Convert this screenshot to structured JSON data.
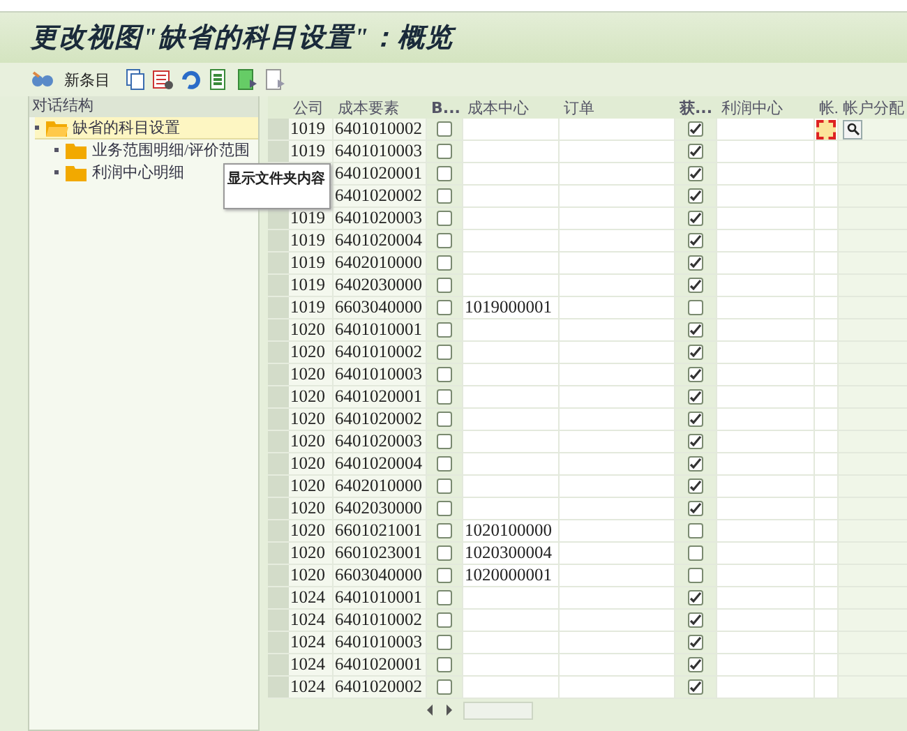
{
  "window": {
    "title": "更改视图\"缺省的科目设置\"：概览"
  },
  "toolbar": {
    "new_entry": "新条目"
  },
  "tree": {
    "header": "对话结构",
    "items": [
      {
        "label": "缺省的科目设置",
        "selected": true,
        "expanded": true,
        "children": [
          {
            "label": "业务范围明细/评价范围",
            "selected": false
          },
          {
            "label": "利润中心明细",
            "selected": false
          }
        ]
      }
    ]
  },
  "tooltip": "显示文件夹内容",
  "table": {
    "columns": [
      "公司",
      "成本要素",
      "B...",
      "成本中心",
      "订单",
      "获...",
      "利润中心",
      "帐.",
      "帐户分配"
    ],
    "rows": [
      {
        "company": "1019",
        "cost_element": "6401010002",
        "b_checked": false,
        "cost_center": "",
        "obtain_checked": true,
        "input_active": true
      },
      {
        "company": "1019",
        "cost_element": "6401010003",
        "b_checked": false,
        "obtain_checked": true,
        "input_active": false
      },
      {
        "cost_element": "6401020001",
        "b_checked": false,
        "obtain_checked": true,
        "input_active": false
      },
      {
        "cost_element": "6401020002",
        "b_checked": false,
        "obtain_checked": true,
        "input_active": false
      },
      {
        "company": "1019",
        "cost_element": "6401020003",
        "b_checked": false,
        "obtain_checked": true,
        "input_active": false
      },
      {
        "company": "1019",
        "cost_element": "6401020004",
        "b_checked": false,
        "obtain_checked": true,
        "input_active": false
      },
      {
        "company": "1019",
        "cost_element": "6402010000",
        "b_checked": false,
        "obtain_checked": true,
        "input_active": false
      },
      {
        "company": "1019",
        "cost_element": "6402030000",
        "b_checked": false,
        "obtain_checked": true,
        "input_active": false
      },
      {
        "company": "1019",
        "cost_element": "6603040000",
        "b_checked": false,
        "cost_center": "1019000001",
        "obtain_checked": false,
        "input_active": false
      },
      {
        "company": "1020",
        "cost_element": "6401010001",
        "b_checked": false,
        "obtain_checked": true,
        "input_active": false
      },
      {
        "company": "1020",
        "cost_element": "6401010002",
        "b_checked": false,
        "obtain_checked": true,
        "input_active": false
      },
      {
        "company": "1020",
        "cost_element": "6401010003",
        "b_checked": false,
        "obtain_checked": true,
        "input_active": false
      },
      {
        "company": "1020",
        "cost_element": "6401020001",
        "b_checked": false,
        "obtain_checked": true,
        "input_active": false
      },
      {
        "company": "1020",
        "cost_element": "6401020002",
        "b_checked": false,
        "obtain_checked": true,
        "input_active": false
      },
      {
        "company": "1020",
        "cost_element": "6401020003",
        "b_checked": false,
        "obtain_checked": true,
        "input_active": false
      },
      {
        "company": "1020",
        "cost_element": "6401020004",
        "b_checked": false,
        "obtain_checked": true,
        "input_active": false
      },
      {
        "company": "1020",
        "cost_element": "6402010000",
        "b_checked": false,
        "obtain_checked": true,
        "input_active": false
      },
      {
        "company": "1020",
        "cost_element": "6402030000",
        "b_checked": false,
        "obtain_checked": true,
        "input_active": false
      },
      {
        "company": "1020",
        "cost_element": "6601021001",
        "b_checked": false,
        "cost_center": "1020100000",
        "obtain_checked": false,
        "input_active": false
      },
      {
        "company": "1020",
        "cost_element": "6601023001",
        "b_checked": false,
        "cost_center": "1020300004",
        "obtain_checked": false,
        "input_active": false
      },
      {
        "company": "1020",
        "cost_element": "6603040000",
        "b_checked": false,
        "cost_center": "1020000001",
        "obtain_checked": false,
        "input_active": false
      },
      {
        "company": "1024",
        "cost_element": "6401010001",
        "b_checked": false,
        "obtain_checked": true,
        "input_active": false
      },
      {
        "company": "1024",
        "cost_element": "6401010002",
        "b_checked": false,
        "obtain_checked": true,
        "input_active": false
      },
      {
        "company": "1024",
        "cost_element": "6401010003",
        "b_checked": false,
        "obtain_checked": true,
        "input_active": false
      },
      {
        "company": "1024",
        "cost_element": "6401020001",
        "b_checked": false,
        "obtain_checked": true,
        "input_active": false
      },
      {
        "company": "1024",
        "cost_element": "6401020002",
        "b_checked": false,
        "obtain_checked": true,
        "input_active": false
      }
    ]
  }
}
